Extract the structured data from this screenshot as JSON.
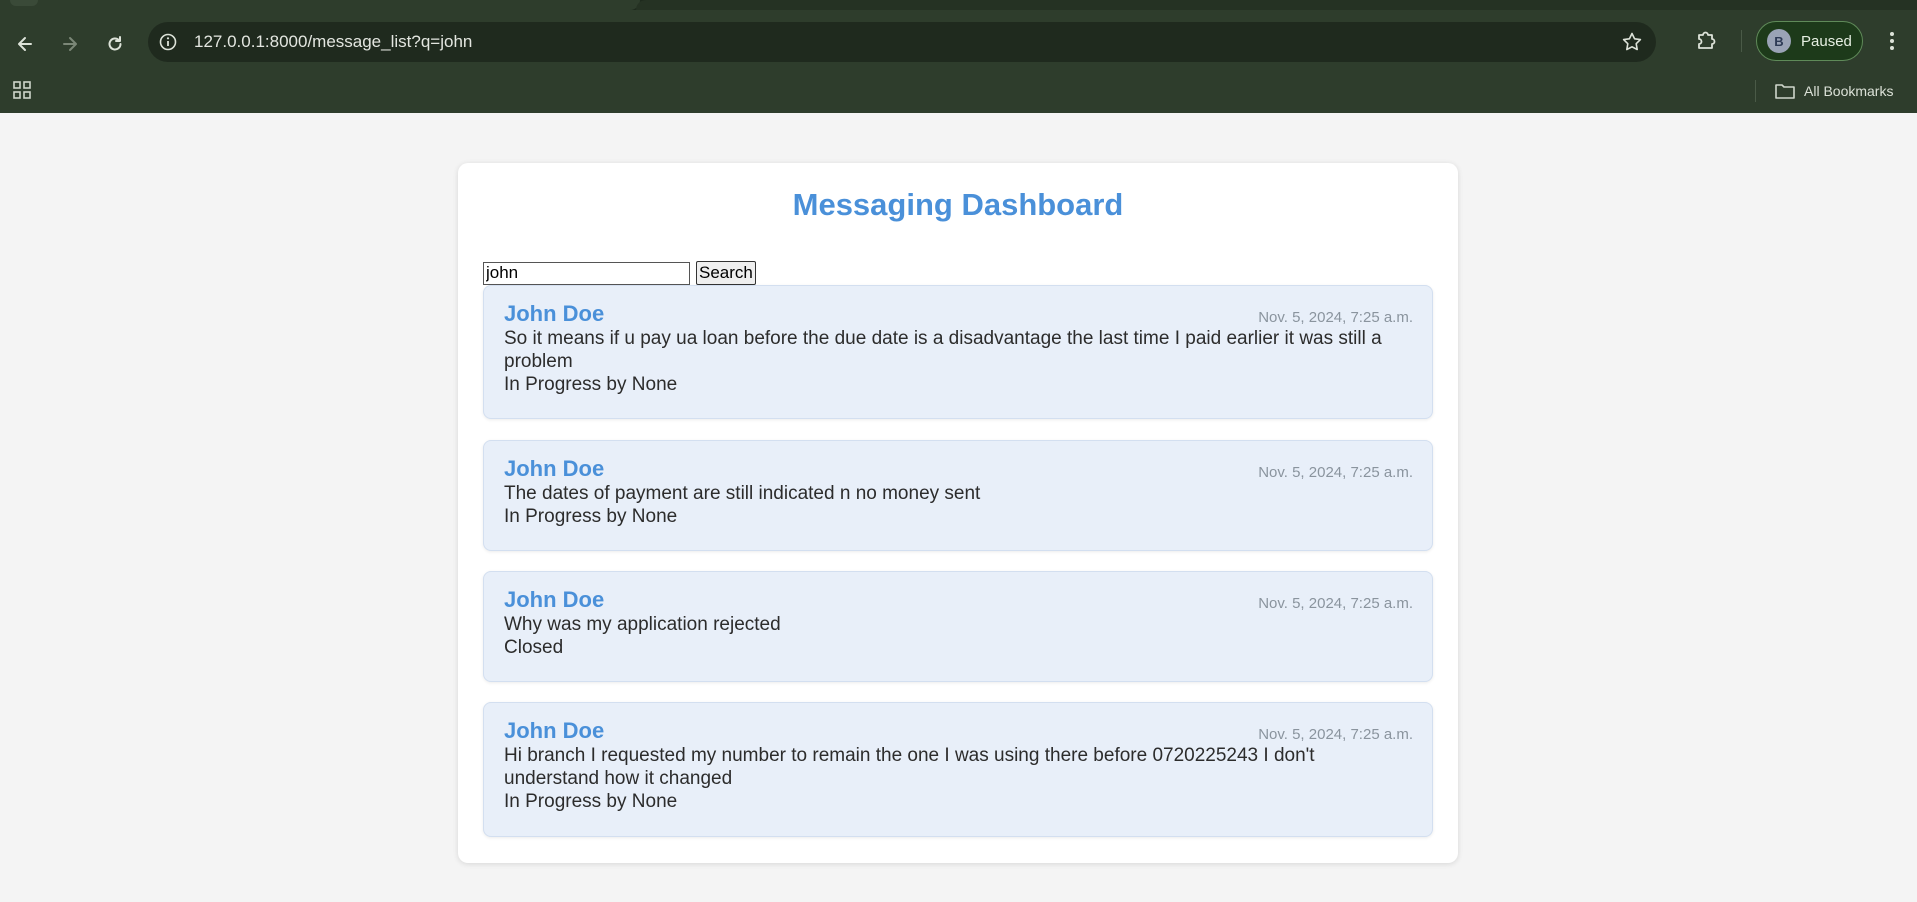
{
  "browser": {
    "url": "127.0.0.1:8000/message_list?q=john",
    "profile_initial": "B",
    "profile_label": "Paused",
    "all_bookmarks_label": "All Bookmarks"
  },
  "page": {
    "title": "Messaging Dashboard",
    "search": {
      "value": "john",
      "button_label": "Search"
    },
    "messages": [
      {
        "sender": "John Doe",
        "date": "Nov. 5, 2024, 7:25 a.m.",
        "text": "So it means if u pay ua loan before the due date is a disadvantage the last time I paid earlier it was still a problem",
        "status": "In Progress by None"
      },
      {
        "sender": "John Doe",
        "date": "Nov. 5, 2024, 7:25 a.m.",
        "text": "The dates of payment are still indicated n no money sent",
        "status": "In Progress by None"
      },
      {
        "sender": "John Doe",
        "date": "Nov. 5, 2024, 7:25 a.m.",
        "text": "Why was my application rejected",
        "status": "Closed"
      },
      {
        "sender": "John Doe",
        "date": "Nov. 5, 2024, 7:25 a.m.",
        "text": "Hi branch I requested my number to remain the one I was using there before 0720225243 I don't understand how it changed",
        "status": "In Progress by None"
      }
    ]
  },
  "colors": {
    "accent": "#4a90d9",
    "message_bg": "#e8eff9",
    "chrome_bg": "#2e3d2c"
  }
}
